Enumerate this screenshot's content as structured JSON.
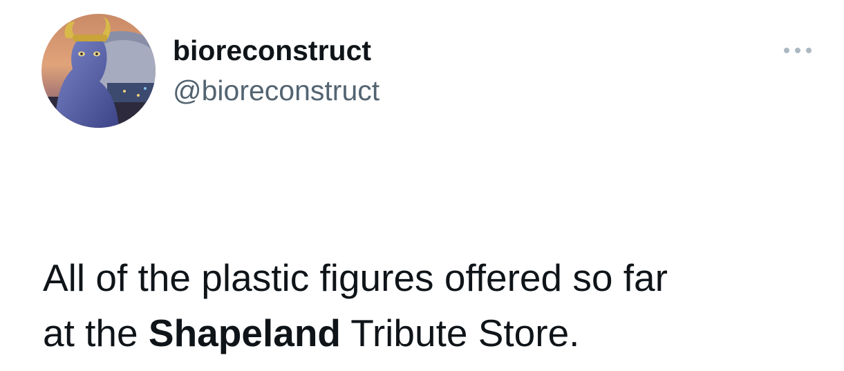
{
  "tweet": {
    "author": {
      "display_name": "bioreconstruct",
      "handle": "@bioreconstruct",
      "avatar_icon": "avatar-image"
    },
    "menu_icon": "more-options-icon",
    "text": {
      "line1": "All of the plastic figures offered so far",
      "line2_prefix": "at the ",
      "line2_bold": "Shapeland",
      "line2_suffix": " Tribute Store."
    }
  },
  "colors": {
    "primary_text": "#0f1419",
    "secondary_text": "#536471",
    "menu_dots": "#aab8c2",
    "background": "#ffffff"
  }
}
